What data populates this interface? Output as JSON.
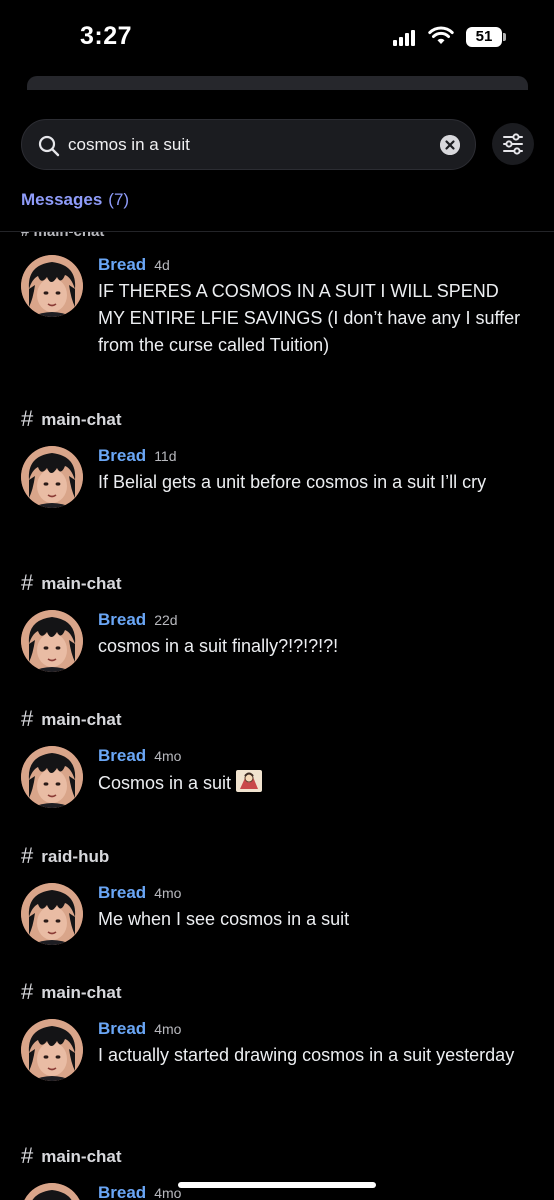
{
  "status_bar": {
    "time": "3:27",
    "battery": "51"
  },
  "search": {
    "query": "cosmos in a suit"
  },
  "tabs": {
    "messages_label": "Messages",
    "messages_count": "(7)"
  },
  "colors": {
    "accent": "#8f9cf9",
    "author": "#6aa6f5",
    "background": "#000000"
  },
  "icons": [
    "search-icon",
    "clear-icon",
    "filter-icon",
    "hash-icon"
  ],
  "results": [
    {
      "channel": "",
      "author": "Bread",
      "age": "4d",
      "text": "IF THERES A COSMOS IN A SUIT I WILL SPEND MY ENTIRE LFIE SAVINGS (I don’t have any I suffer from the curse called Tuition)"
    },
    {
      "channel": "main-chat",
      "author": "Bread",
      "age": "11d",
      "text": "If Belial gets a unit before cosmos in a suit I’ll cry"
    },
    {
      "channel": "main-chat",
      "author": "Bread",
      "age": "22d",
      "text": "cosmos in a suit finally?!?!?!?!"
    },
    {
      "channel": "main-chat",
      "author": "Bread",
      "age": "4mo",
      "text": "Cosmos in a suit"
    },
    {
      "channel": "raid-hub",
      "author": "Bread",
      "age": "4mo",
      "text": "Me when I see cosmos in a suit"
    },
    {
      "channel": "main-chat",
      "author": "Bread",
      "age": "4mo",
      "text": "I actually started drawing cosmos in a suit yesterday"
    },
    {
      "channel": "main-chat",
      "author": "Bread",
      "age": "4mo",
      "text": ""
    }
  ]
}
